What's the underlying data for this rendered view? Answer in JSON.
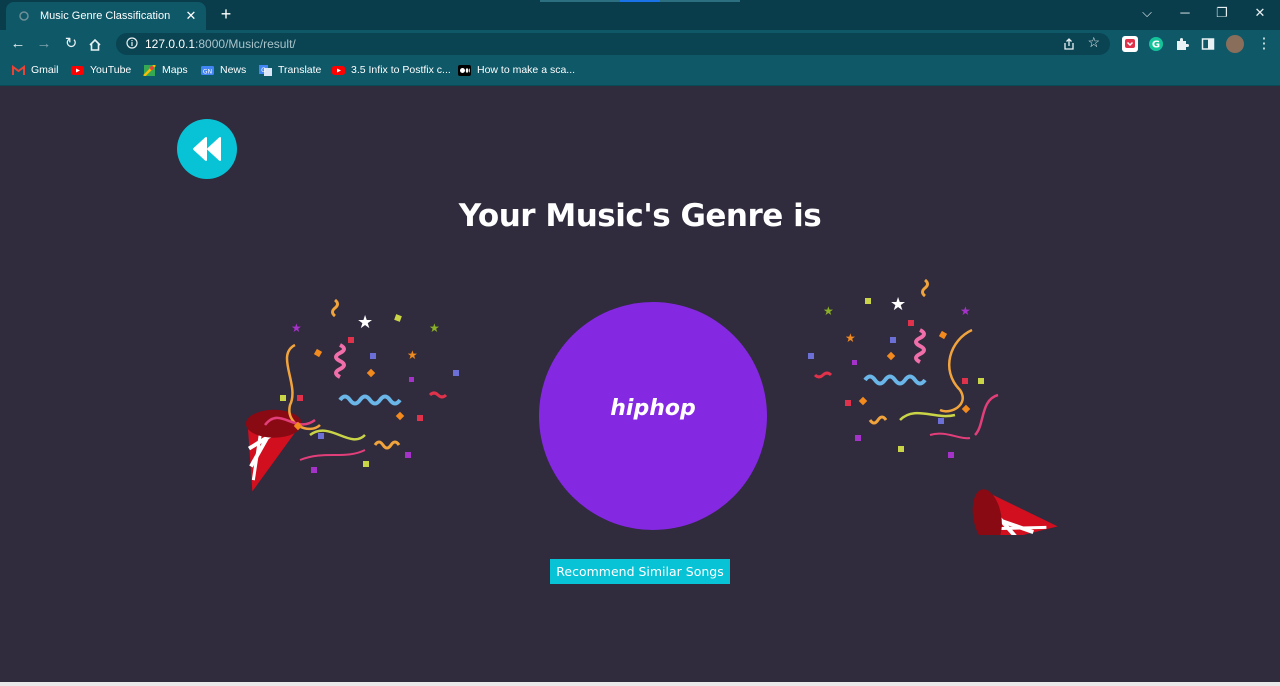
{
  "browser": {
    "tab_title": "Music Genre Classification",
    "tab_close": "✕",
    "new_tab": "+",
    "url_host": "127.0.0.1",
    "url_path": ":8000/Music/result/",
    "bookmarks": [
      {
        "label": "Gmail",
        "icon": "gmail-icon",
        "color": "#ea4335"
      },
      {
        "label": "YouTube",
        "icon": "youtube-icon",
        "color": "#ff0000"
      },
      {
        "label": "Maps",
        "icon": "maps-icon",
        "color": "#34a853"
      },
      {
        "label": "News",
        "icon": "news-icon",
        "color": "#4285f4"
      },
      {
        "label": "Translate",
        "icon": "translate-icon",
        "color": "#4285f4"
      },
      {
        "label": "3.5 Infix to Postfix c...",
        "icon": "youtube-icon",
        "color": "#ff0000"
      },
      {
        "label": "How to make a sca...",
        "icon": "medium-icon",
        "color": "#000000"
      }
    ]
  },
  "page": {
    "heading": "Your Music's Genre is",
    "genre": "hiphop",
    "recommend_button": "Recommend Similar Songs"
  },
  "colors": {
    "background": "#302b3d",
    "accent_cyan": "#08c3d6",
    "genre_purple": "#8428e2"
  }
}
